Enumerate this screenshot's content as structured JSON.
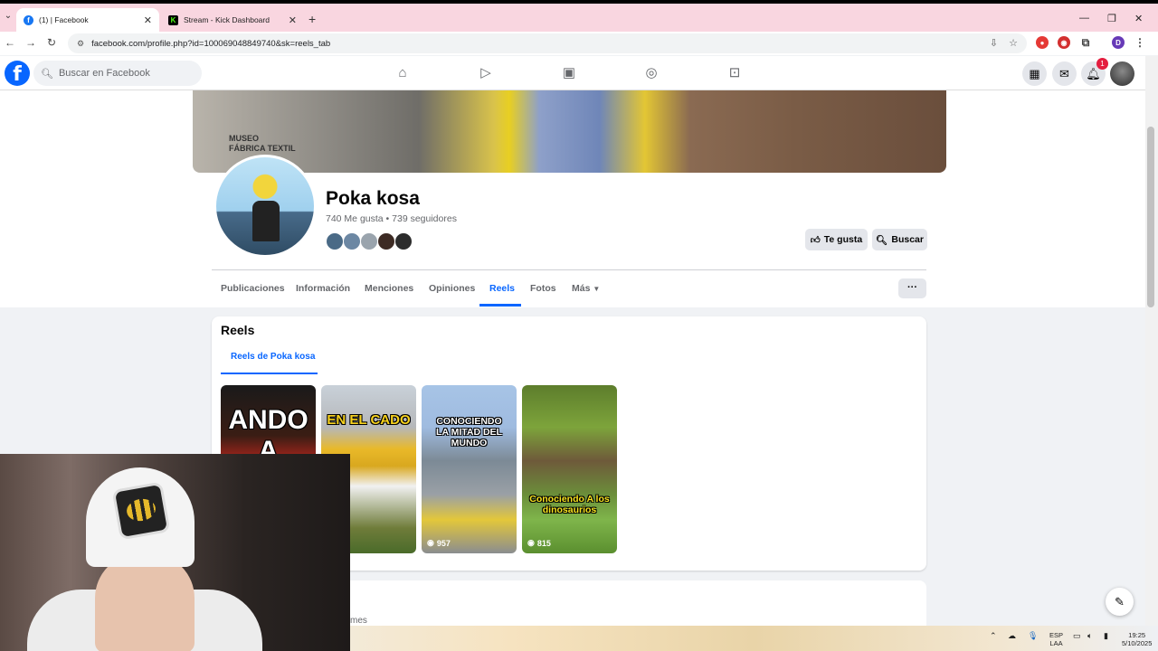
{
  "browser": {
    "tabs": [
      {
        "label": "(1) | Facebook",
        "active": true
      },
      {
        "label": "Stream - Kick Dashboard",
        "active": false
      }
    ],
    "url": "facebook.com/profile.php?id=100069048849740&sk=reels_tab",
    "profile_initial": "D"
  },
  "fb_header": {
    "search_placeholder": "Buscar en Facebook",
    "notification_count": "1",
    "nav_icons": [
      "home-icon",
      "video-icon",
      "marketplace-icon",
      "groups-icon",
      "gaming-icon"
    ]
  },
  "profile": {
    "name": "Poka kosa",
    "stats": "740 Me gusta • 739 seguidores",
    "like_button": "Te gusta",
    "search_button": "Buscar",
    "cover_sign": "MUSEO\nFÁBRICA TEXTIL"
  },
  "profile_tabs": [
    {
      "label": "Publicaciones",
      "active": false
    },
    {
      "label": "Información",
      "active": false
    },
    {
      "label": "Menciones",
      "active": false
    },
    {
      "label": "Opiniones",
      "active": false
    },
    {
      "label": "Reels",
      "active": true
    },
    {
      "label": "Fotos",
      "active": false
    },
    {
      "label": "Más",
      "active": false
    }
  ],
  "more_button": "···",
  "reels": {
    "title": "Reels",
    "subtab": "Reels de Poka kosa",
    "items": [
      {
        "overlay": "ANDO A",
        "views": ""
      },
      {
        "overlay": "EN EL CADO",
        "views": ""
      },
      {
        "overlay": "CONOCIENDO LA MITAD DEL MUNDO",
        "views": "957"
      },
      {
        "overlay": "Conociendo A los dinosaurios",
        "views": "815"
      }
    ]
  },
  "next_section_partial_text": "mes",
  "taskbar": {
    "lang_top": "ESP",
    "lang_bottom": "LAA",
    "time": "19:25",
    "date": "5/10/2025"
  },
  "colors": {
    "facebook_blue": "#0866ff",
    "tabbar_pink": "#f9d6e0"
  }
}
